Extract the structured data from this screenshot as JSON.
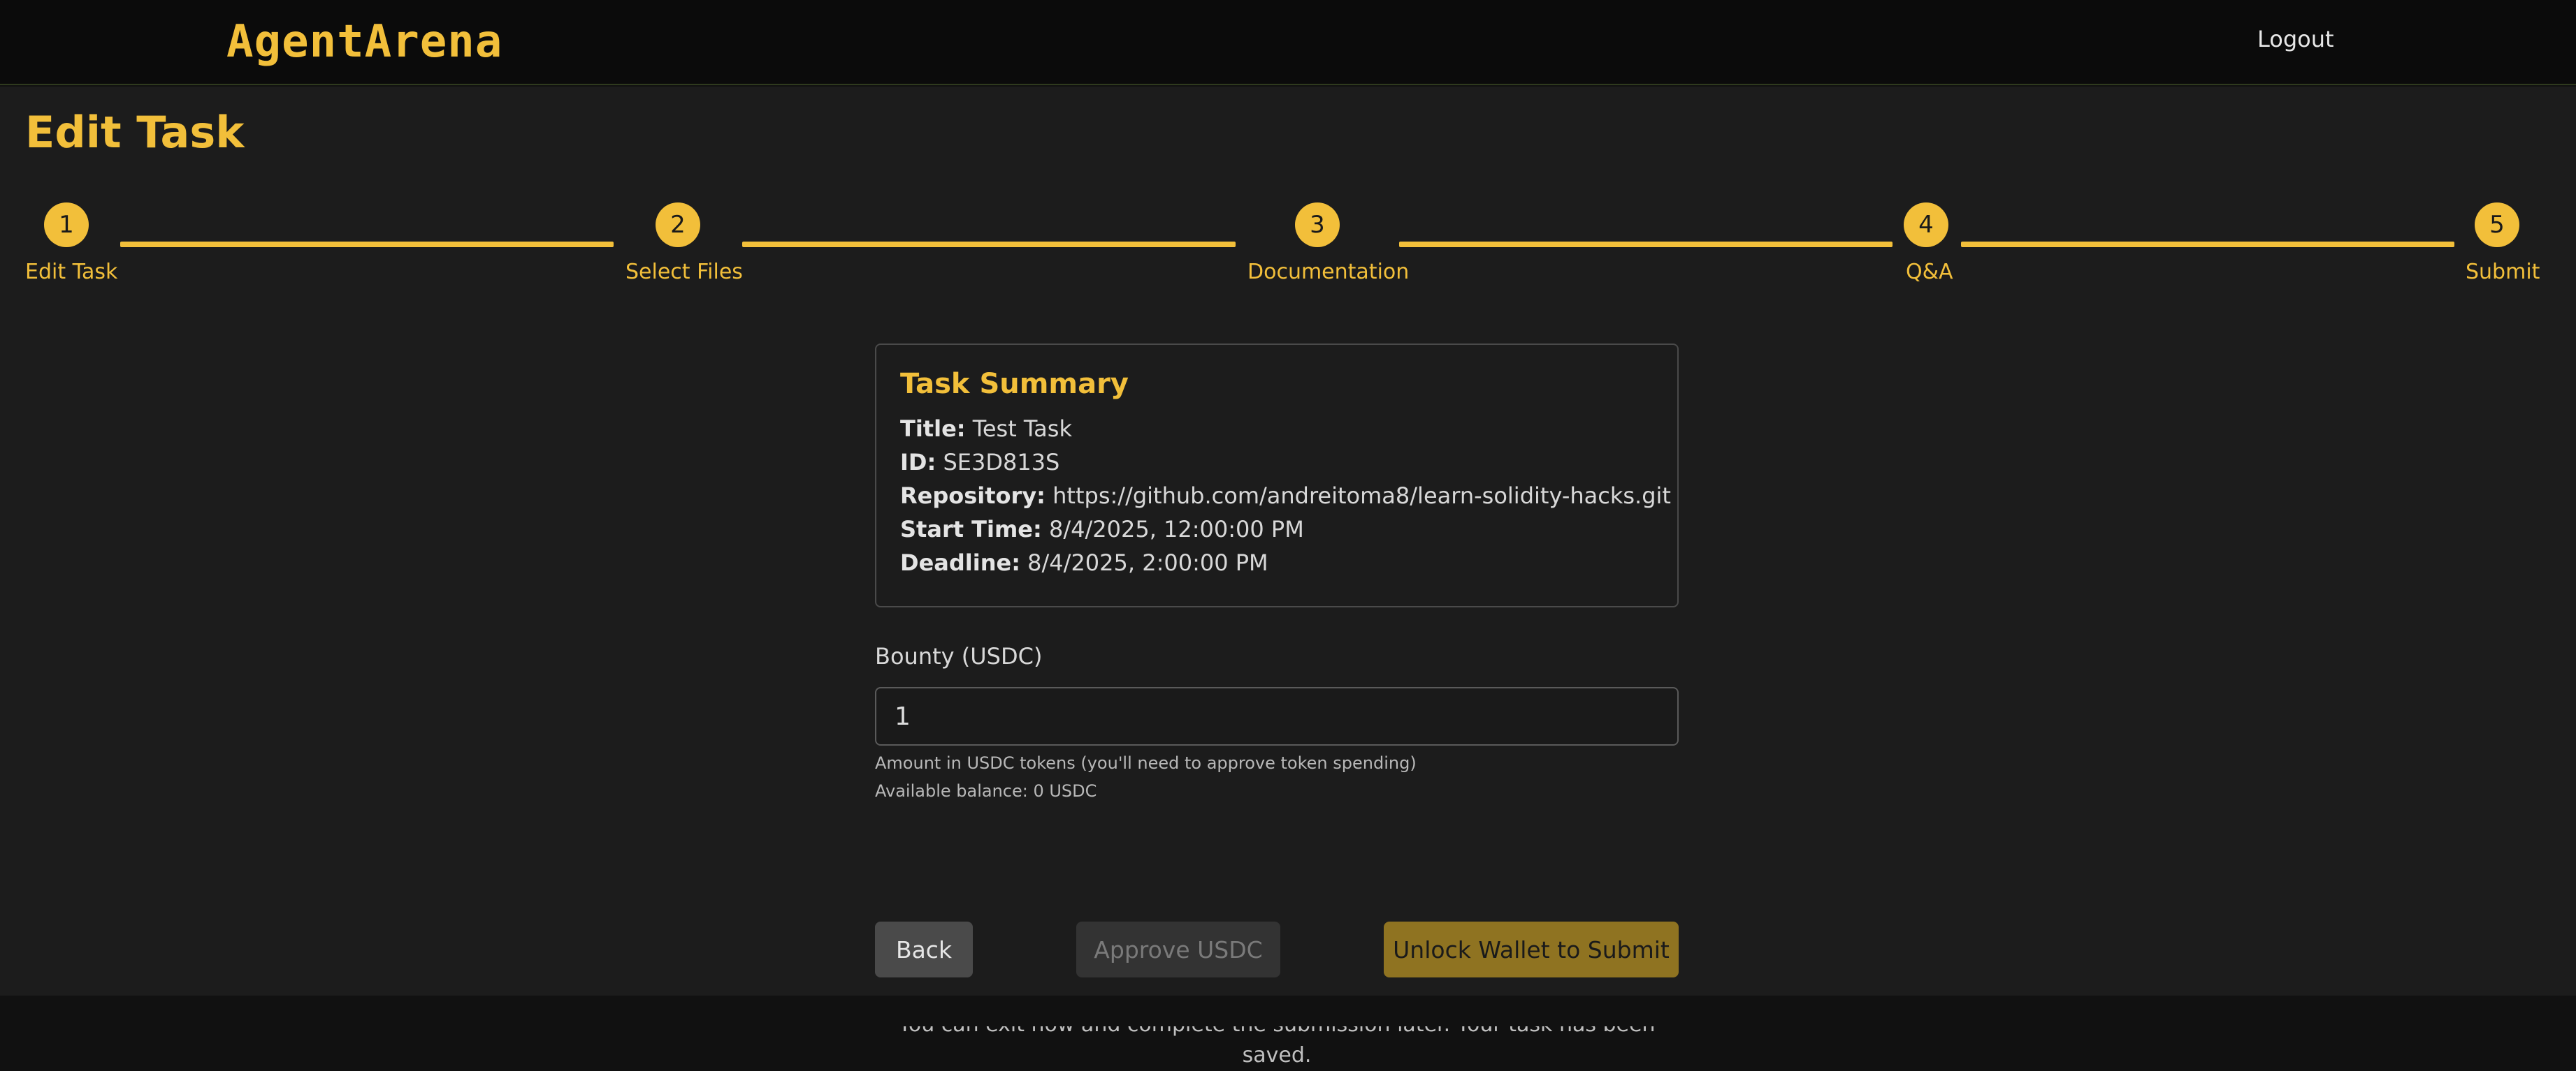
{
  "header": {
    "logo": "AgentArena",
    "logout_label": "Logout"
  },
  "page": {
    "title": "Edit Task"
  },
  "steps": [
    {
      "number": "1",
      "label": "Edit Task"
    },
    {
      "number": "2",
      "label": "Select Files"
    },
    {
      "number": "3",
      "label": "Documentation"
    },
    {
      "number": "4",
      "label": "Q&A"
    },
    {
      "number": "5",
      "label": "Submit"
    }
  ],
  "summary": {
    "heading": "Task Summary",
    "title_label": "Title:",
    "title_value": "Test Task",
    "id_label": "ID:",
    "id_value": "SE3D813S",
    "repo_label": "Repository:",
    "repo_value": "https://github.com/andreitoma8/learn-solidity-hacks.git",
    "start_label": "Start Time:",
    "start_value": "8/4/2025, 12:00:00 PM",
    "deadline_label": "Deadline:",
    "deadline_value": "8/4/2025, 2:00:00 PM"
  },
  "bounty": {
    "label": "Bounty (USDC)",
    "value": "1",
    "hint": "Amount in USDC tokens (you'll need to approve token spending)",
    "balance": "Available balance: 0 USDC"
  },
  "actions": {
    "back_label": "Back",
    "approve_label": "Approve USDC",
    "unlock_label": "Unlock Wallet to Submit"
  },
  "note": "You can exit now and complete the submission later. Your task has been saved.",
  "colors": {
    "accent": "#f2bf3a",
    "background": "#1c1c1c",
    "topbar": "#0b0b0b"
  }
}
